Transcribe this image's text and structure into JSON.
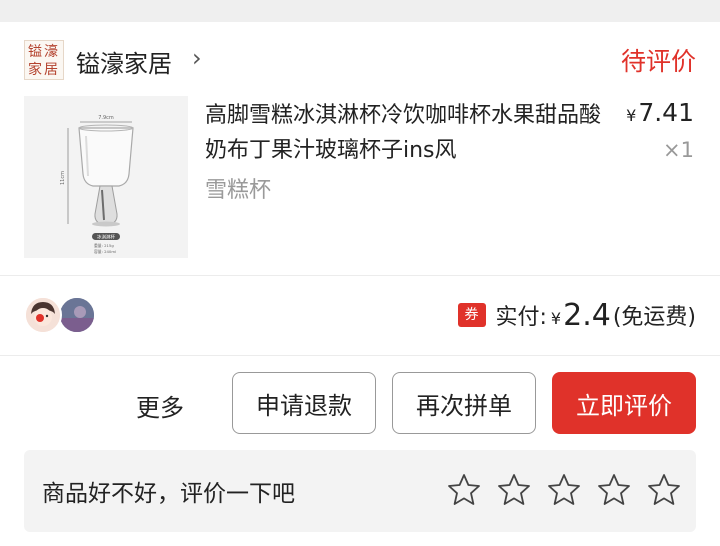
{
  "shop": {
    "name": "镒濠家居",
    "logo_text": "镒濠家居",
    "chevron": "›",
    "status": "待评价"
  },
  "product": {
    "title": "高脚雪糕冰淇淋杯冷饮咖啡杯水果甜品酸奶布丁果汁玻璃杯子ins风",
    "spec": "雪糕杯",
    "price_symbol": "¥",
    "price": "7.41",
    "quantity": "×1",
    "image_labels": {
      "width": "7.9cm",
      "height": "11cm",
      "badge": "冰淇淋杯",
      "weight": "重量: 215g",
      "capacity": "容量: 240ml"
    }
  },
  "payment": {
    "coupon_label": "券",
    "label": "实付:",
    "symbol": "¥",
    "amount": "2.4",
    "note": "(免运费)"
  },
  "actions": {
    "more": "更多",
    "refund": "申请退款",
    "reorder": "再次拼单",
    "review": "立即评价"
  },
  "review_prompt": {
    "text": "商品好不好，评价一下吧",
    "star_count": 5
  },
  "colors": {
    "accent": "#e0322a",
    "background": "#efefef",
    "muted_text": "#9a9a9a"
  }
}
